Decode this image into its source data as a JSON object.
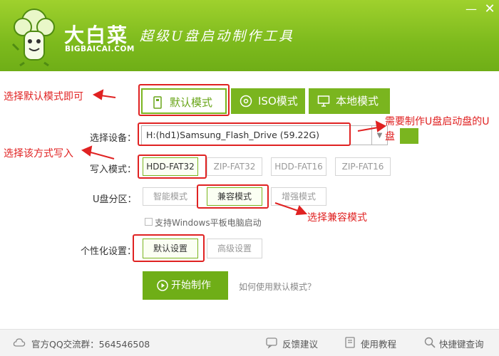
{
  "app": {
    "brand": "大白菜",
    "brand_url": "BIGBAICAI.COM",
    "slogan": "超级U盘启动制作工具",
    "min_label": "—",
    "close_label": "✕"
  },
  "modes": [
    {
      "label": "默认模式",
      "icon": "usb-icon",
      "selected": true
    },
    {
      "label": "ISO模式",
      "icon": "disc-icon",
      "selected": false
    },
    {
      "label": "本地模式",
      "icon": "monitor-icon",
      "selected": false
    }
  ],
  "form": {
    "device_label": "选择设备：",
    "device_value": "H:(hd1)Samsung_Flash_Drive (59.22G)",
    "write_label": "写入模式：",
    "write_options": [
      "HDD-FAT32",
      "ZIP-FAT32",
      "HDD-FAT16",
      "ZIP-FAT16"
    ],
    "write_selected": "HDD-FAT32",
    "partition_label": "U盘分区：",
    "partition_options": [
      "智能模式",
      "兼容模式",
      "增强模式"
    ],
    "partition_selected": "兼容模式",
    "windows_tablet_label": "支持Windows平板电脑启动",
    "personal_label": "个性化设置：",
    "personal_options": [
      "默认设置",
      "高级设置"
    ],
    "personal_selected": "默认设置"
  },
  "start_label": "开始制作",
  "help_link": "如何使用默认模式？",
  "footer": {
    "qq_group": "官方QQ交流群：564546508",
    "feedback": "反馈建议",
    "tutorial": "使用教程",
    "shortcut": "快捷键查询"
  },
  "annotations": {
    "default_mode": "选择默认模式即可",
    "u_disk": "需要制作U盘启动盘的U盘",
    "write_mode": "选择该方式写入",
    "compat_mode": "选择兼容模式"
  },
  "colors": {
    "brand_green": "#7ab51f",
    "annotation_red": "#e02222"
  }
}
